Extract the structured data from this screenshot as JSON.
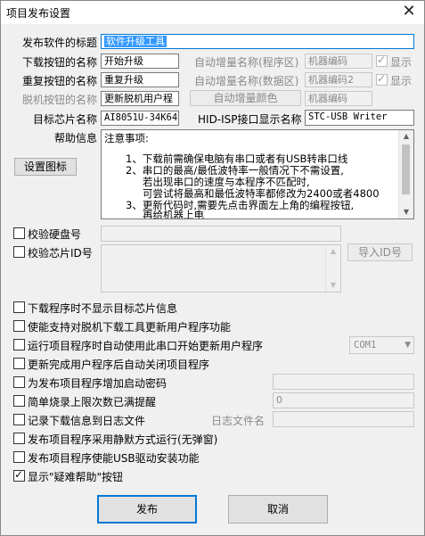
{
  "window": {
    "title": "项目发布设置",
    "close_symbol": "✕"
  },
  "rows": {
    "title_label": "发布软件的标题",
    "title_value": "软件升级工具",
    "download_label": "下载按钮的名称",
    "download_value": "开始升级",
    "auto_prog_label": "自动增量名称(程序区)",
    "machine_code_1": "机器编码",
    "show_1": "显示",
    "redownload_label": "重复按钮的名称",
    "redownload_value": "重复升级",
    "auto_data_label": "自动增量名称(数据区)",
    "machine_code_2": "机器编码2",
    "show_2": "显示",
    "offline_label": "脱机按钮的名称",
    "offline_value": "更新脱机用户程",
    "auto_color_button": "自动增量颜色",
    "machine_code_3": "机器编码",
    "chip_label": "目标芯片名称",
    "chip_value": "AI8051U-34K64",
    "hid_label": "HID-ISP接口显示名称",
    "hid_value": "STC-USB Writer",
    "help_label": "帮助信息",
    "set_icon_button": "设置图标"
  },
  "help_text": [
    "注意事项:",
    "1、下载前需确保电脑有串口或者有USB转串口线",
    "2、串口的最高/最低波特率一般情况下不需设置,",
    "若出现串口的速度与本程序不匹配时,",
    "可尝试将最高和最低波特率都修改为2400或者4800",
    "3、更新代码时,需要先点击界面左上角的编程按钮,",
    "再给机器上电"
  ],
  "verify": {
    "disk_label": "校验硬盘号",
    "chip_id_label": "校验芯片ID号",
    "import_id_button": "导入ID号"
  },
  "options": [
    {
      "label": "下载程序时不显示目标芯片信息",
      "checked": false
    },
    {
      "label": "使能支持对脱机下载工具更新用户程序功能",
      "checked": false
    },
    {
      "label": "运行项目程序时自动使用此串口开始更新用户程序",
      "checked": false
    },
    {
      "label": "更新完成用户程序后自动关闭项目程序",
      "checked": false
    },
    {
      "label": "为发布项目程序增加启动密码",
      "checked": false
    },
    {
      "label": "简单烧录上限次数已满提醒",
      "checked": false
    },
    {
      "label": "记录下载信息到日志文件",
      "checked": false
    },
    {
      "label": "发布项目程序采用静默方式运行(无弹窗)",
      "checked": false
    },
    {
      "label": "发布项目程序使能USB驱动安装功能",
      "checked": false
    },
    {
      "label": "显示\"疑难帮助\"按钮",
      "checked": true
    }
  ],
  "com_port": "COM1",
  "limit_count": "0",
  "log_file_label": "日志文件名",
  "footer": {
    "publish_button": "发布",
    "cancel_button": "取消"
  }
}
